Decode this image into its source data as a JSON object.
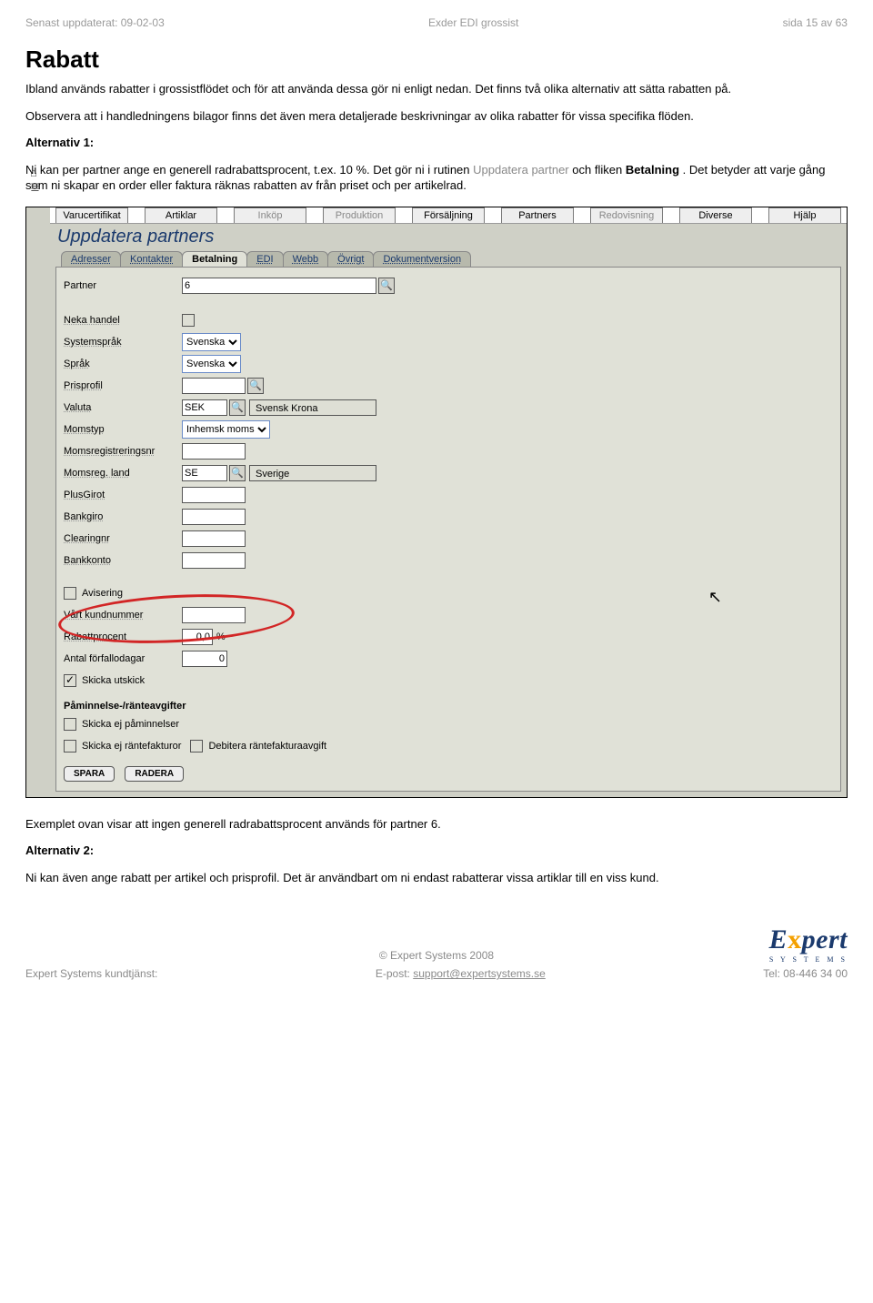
{
  "header": {
    "updated": "Senast uppdaterat: 09-02-03",
    "title": "Exder EDI grossist",
    "page": "sida 15 av 63"
  },
  "doc": {
    "h1": "Rabatt",
    "p1": "Ibland används rabatter i grossistflödet och för att använda dessa gör ni enligt nedan. Det finns två olika alternativ att sätta rabatten på.",
    "p2": "Observera att i handledningens bilagor finns det även mera detaljerade beskrivningar av olika rabatter för vissa specifika flöden.",
    "alt1": "Alternativ 1:",
    "p3a": "Ni kan per partner ange en generell radrabattsprocent, t.ex. 10 %. Det gör ni i rutinen ",
    "p3link": "Uppdatera partner",
    "p3b": " och fliken ",
    "p3bold": "Betalning",
    "p3c": ". Det betyder att varje gång som ni skapar en order eller faktura räknas rabatten av från priset och per artikelrad.",
    "after1": "Exemplet ovan visar att ingen generell radrabattsprocent används för partner 6.",
    "alt2": "Alternativ 2:",
    "after2": "Ni kan även ange rabatt per artikel och prisprofil. Det är användbart om ni endast rabatterar vissa artiklar till en viss kund."
  },
  "app": {
    "menu": [
      "Varucertifikat",
      "Artiklar",
      "Inköp",
      "Produktion",
      "Försäljning",
      "Partners",
      "Redovisning",
      "Diverse",
      "Hjälp"
    ],
    "dimIdx": [
      2,
      3,
      6
    ],
    "screenTitle": "Uppdatera partners",
    "subtabs": [
      "Adresser",
      "Kontakter",
      "Betalning",
      "EDI",
      "Webb",
      "Övrigt",
      "Dokumentversion"
    ],
    "activeSub": 2,
    "partnerLabel": "Partner",
    "partnerValue": "6",
    "fields": {
      "neka": "Neka handel",
      "sysLang": "Systemspråk",
      "sysLangVal": "Svenska",
      "lang": "Språk",
      "langVal": "Svenska",
      "pris": "Prisprofil",
      "valuta": "Valuta",
      "valutaVal": "SEK",
      "valutaName": "Svensk Krona",
      "momstyp": "Momstyp",
      "momstypVal": "Inhemsk moms",
      "momsreg": "Momsregistreringsnr",
      "momsland": "Momsreg. land",
      "momslandVal": "SE",
      "momslandName": "Sverige",
      "plusgirot": "PlusGirot",
      "bankgiro": "Bankgiro",
      "clearing": "Clearingnr",
      "bankkonto": "Bankkonto",
      "avisering": "Avisering",
      "kundnr": "Vårt kundnummer",
      "rabatt": "Rabattprocent",
      "rabattVal": "0,0",
      "rabattUnit": "%",
      "forfallo": "Antal förfallodagar",
      "forfalloVal": "0",
      "utskick": "Skicka utskick",
      "remindHead": "Påminnelse-/ränteavgifter",
      "remind1": "Skicka ej påminnelser",
      "remind2": "Skicka ej räntefakturor",
      "remind3": "Debitera räntefakturaavgift",
      "save": "SPARA",
      "delete": "RADERA"
    }
  },
  "footer": {
    "copyright": "© Expert Systems 2008",
    "left": "Expert Systems kundtjänst:",
    "midPrefix": "E-post: ",
    "midLink": "support@expertsystems.se",
    "right": "Tel: 08-446 34 00",
    "logo1": "E",
    "logo2": "x",
    "logo3": "pert",
    "logoSub": "S Y S T E M S"
  }
}
